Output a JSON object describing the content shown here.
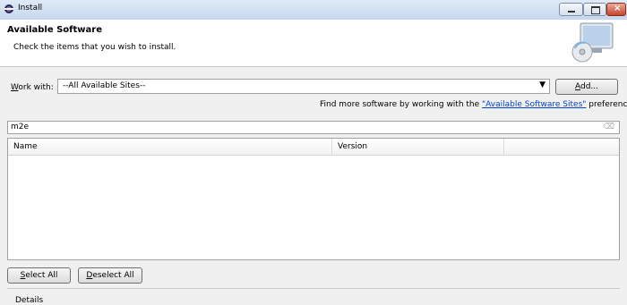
{
  "window": {
    "title": "Install",
    "controls": {
      "minimize": "minimize-icon",
      "maximize": "maximize-icon",
      "close": "close-icon"
    }
  },
  "header": {
    "title": "Available Software",
    "subtitle": "Check the items that you wish to install."
  },
  "work_with": {
    "label_prefix": "W",
    "label_rest": "ork with:",
    "value": "--All Available Sites--",
    "add_button_prefix": "A",
    "add_button_rest": "dd..."
  },
  "find_more": {
    "before": "Find more software by working with the ",
    "link": "\"Available Software Sites\"",
    "after": " preferences."
  },
  "filter": {
    "value": "m2e"
  },
  "table": {
    "columns": [
      "Name",
      "Version",
      ""
    ],
    "rows": []
  },
  "buttons": {
    "select_all_prefix": "S",
    "select_all_rest": "elect All",
    "deselect_all_prefix": "D",
    "deselect_all_rest": "eselect All"
  },
  "details_label": "Details",
  "colors": {
    "title_bar": "#c5d7ee",
    "close_button": "#c6452c",
    "link": "#0645c9"
  }
}
